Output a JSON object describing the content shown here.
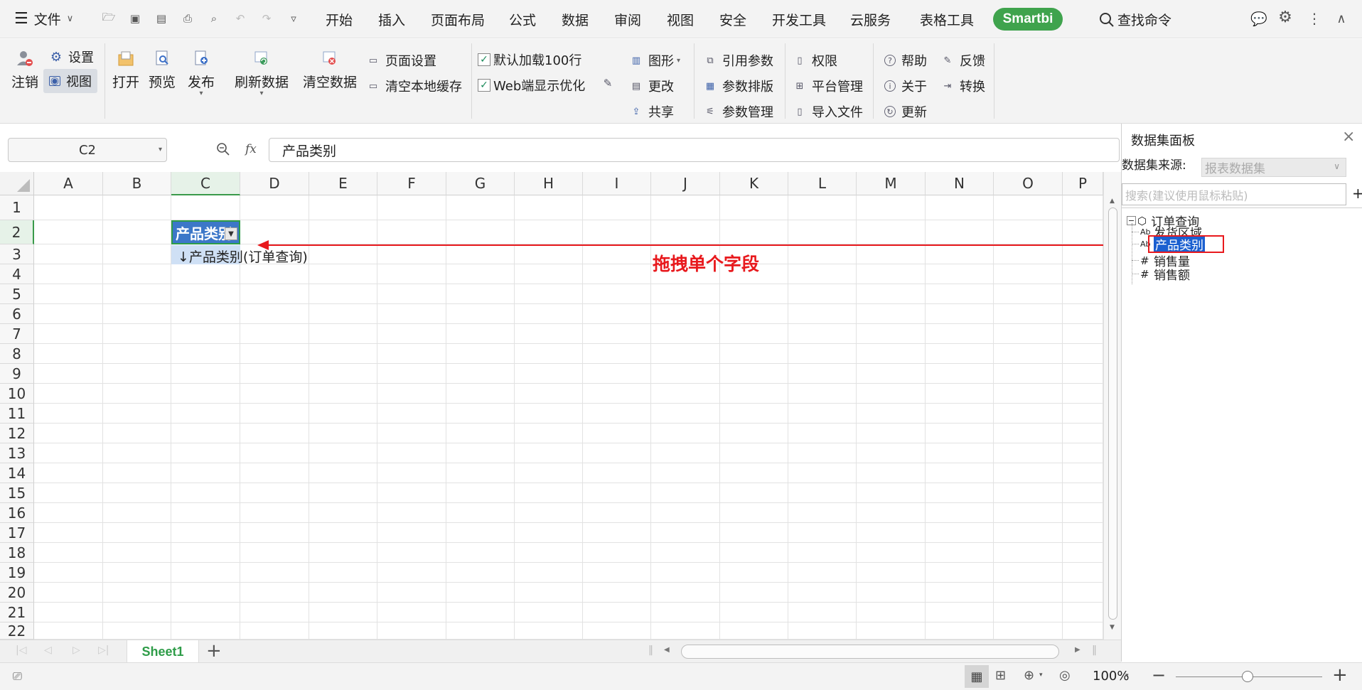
{
  "menubar": {
    "file_label": "文件",
    "tabs": [
      "开始",
      "插入",
      "页面布局",
      "公式",
      "数据",
      "审阅",
      "视图",
      "安全",
      "开发工具",
      "云服务",
      "表格工具"
    ],
    "smartbi_label": "Smartbi",
    "search_label": "查找命令"
  },
  "ribbon": {
    "logout": "注销",
    "settings": "设置",
    "view": "视图",
    "open": "打开",
    "preview": "预览",
    "publish": "发布",
    "refresh": "刷新数据",
    "clear": "清空数据",
    "page_setup": "页面设置",
    "clear_cache": "清空本地缓存",
    "default_load": "默认加载100行",
    "web_optimize": "Web端显示优化",
    "chart": "图形",
    "change": "更改",
    "share": "共享",
    "ref_param": "引用参数",
    "param_layout": "参数排版",
    "param_manage": "参数管理",
    "permission": "权限",
    "platform": "平台管理",
    "import_file": "导入文件",
    "help": "帮助",
    "about": "关于",
    "update": "更新",
    "feedback": "反馈",
    "convert": "转换"
  },
  "formula": {
    "cell_ref": "C2",
    "fx": "fx",
    "value": "产品类别"
  },
  "grid": {
    "columns": [
      "A",
      "B",
      "C",
      "D",
      "E",
      "F",
      "G",
      "H",
      "I",
      "J",
      "K",
      "L",
      "M",
      "N",
      "O",
      "P"
    ],
    "rows": [
      "1",
      "2",
      "3",
      "4",
      "5",
      "6",
      "7",
      "8",
      "9",
      "10",
      "11",
      "12",
      "13",
      "14",
      "15",
      "16",
      "17",
      "18",
      "19",
      "20",
      "21",
      "22"
    ],
    "cell_c2": "产品类别",
    "cell_c3": "↓产品类别(订单查询)",
    "annotation": "拖拽单个字段"
  },
  "panel": {
    "title": "数据集面板",
    "source_label": "数据集来源:",
    "source_value": "报表数据集",
    "search_placeholder": "搜索(建议使用鼠标粘贴)",
    "add_label": "+",
    "tree_root": "订单查询",
    "fields": [
      {
        "type": "Ab",
        "name": "发货区域"
      },
      {
        "type": "Ab",
        "name": "产品类别"
      },
      {
        "type": "#",
        "name": "销售量"
      },
      {
        "type": "#",
        "name": "销售额"
      }
    ]
  },
  "sheet": {
    "tab": "Sheet1",
    "add": "+"
  },
  "status": {
    "zoom": "100%",
    "accent": "#3fa34d",
    "annotation_color": "#e8191d"
  }
}
